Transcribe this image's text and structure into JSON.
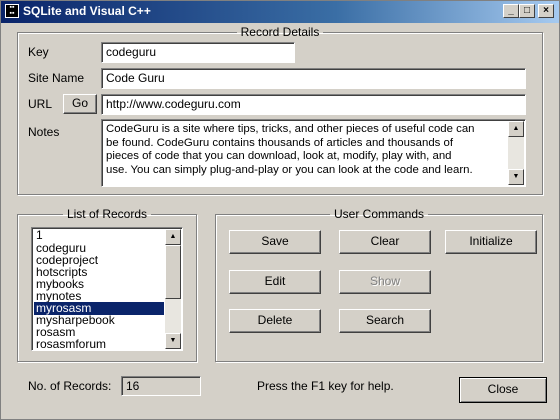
{
  "window": {
    "title": "SQLite and Visual C++"
  },
  "titlebar_buttons": {
    "minimize": "_",
    "maximize": "□",
    "close": "×"
  },
  "record_details": {
    "legend": "Record Details",
    "key_label": "Key",
    "key_value": "codeguru",
    "site_name_label": "Site Name",
    "site_name_value": "Code Guru",
    "url_label": "URL",
    "go_button": "Go",
    "url_value": "http://www.codeguru.com",
    "notes_label": "Notes",
    "notes_lines": [
      "CodeGuru is a site where tips, tricks, and other pieces of useful code can",
      "be found. CodeGuru contains thousands of articles and thousands of",
      "pieces of code that you can download, look at, modify, play with, and",
      "use. You can simply plug-and-play or you can look at the code and learn."
    ]
  },
  "list_of_records": {
    "legend": "List of Records",
    "items": [
      "1",
      "codeguru",
      "codeproject",
      "hotscripts",
      "mybooks",
      "mynotes",
      "myrosasm",
      "mysharpebook",
      "rosasm",
      "rosasmforum"
    ],
    "selected_index": 6
  },
  "user_commands": {
    "legend": "User Commands",
    "save": "Save",
    "clear": "Clear",
    "initialize": "Initialize",
    "edit": "Edit",
    "show": "Show",
    "delete": "Delete",
    "search": "Search"
  },
  "footer": {
    "records_label": "No. of Records:",
    "records_value": "16",
    "help_text": "Press the F1 key for help.",
    "close_button": "Close"
  }
}
